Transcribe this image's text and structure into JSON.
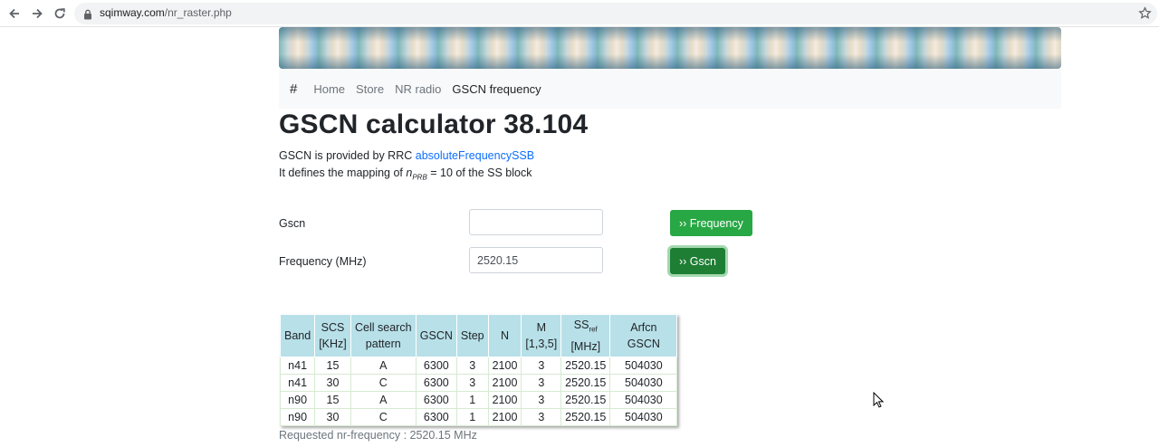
{
  "browser": {
    "url_domain": "sqimway.com",
    "url_path": "/nr_raster.php"
  },
  "navbar": {
    "brand": "#",
    "links": [
      "Home",
      "Store",
      "NR radio",
      "GSCN frequency"
    ]
  },
  "page_title": "GSCN calculator 38.104",
  "intro": {
    "line1_text": "GSCN is provided by RRC ",
    "line1_link": "absoluteFrequencySSB",
    "line2_prefix": "It defines the mapping of ",
    "line2_var": "n",
    "line2_sub": "PRB",
    "line2_suffix": " = 10 of the SS block"
  },
  "form": {
    "gscn_label": "Gscn",
    "gscn_value": "",
    "freq_label": "Frequency (MHz)",
    "freq_value": "2520.15",
    "to_frequency_button": "›› Frequency",
    "to_gscn_button": "›› Gscn"
  },
  "table": {
    "headers": {
      "band": "Band",
      "scs": [
        "SCS",
        "[KHz]"
      ],
      "pattern": [
        "Cell search",
        "pattern"
      ],
      "gscn": "GSCN",
      "step": "Step",
      "n": "N",
      "m": [
        "M",
        "[1,3,5]"
      ],
      "ssref": [
        "SS",
        "ref",
        "[MHz]"
      ],
      "arfcn": "Arfcn GSCN"
    },
    "rows": [
      [
        "n41",
        "15",
        "A",
        "6300",
        "3",
        "2100",
        "3",
        "2520.15",
        "504030"
      ],
      [
        "n41",
        "30",
        "C",
        "6300",
        "3",
        "2100",
        "3",
        "2520.15",
        "504030"
      ],
      [
        "n90",
        "15",
        "A",
        "6300",
        "1",
        "2100",
        "3",
        "2520.15",
        "504030"
      ],
      [
        "n90",
        "30",
        "C",
        "6300",
        "1",
        "2100",
        "3",
        "2520.15",
        "504030"
      ]
    ]
  },
  "requested_text": "Requested nr-frequency : 2520.15 MHz",
  "colors": {
    "accent_green": "#28a745",
    "link_blue": "#0d6efd",
    "table_header_bg": "#b8e0e8"
  }
}
